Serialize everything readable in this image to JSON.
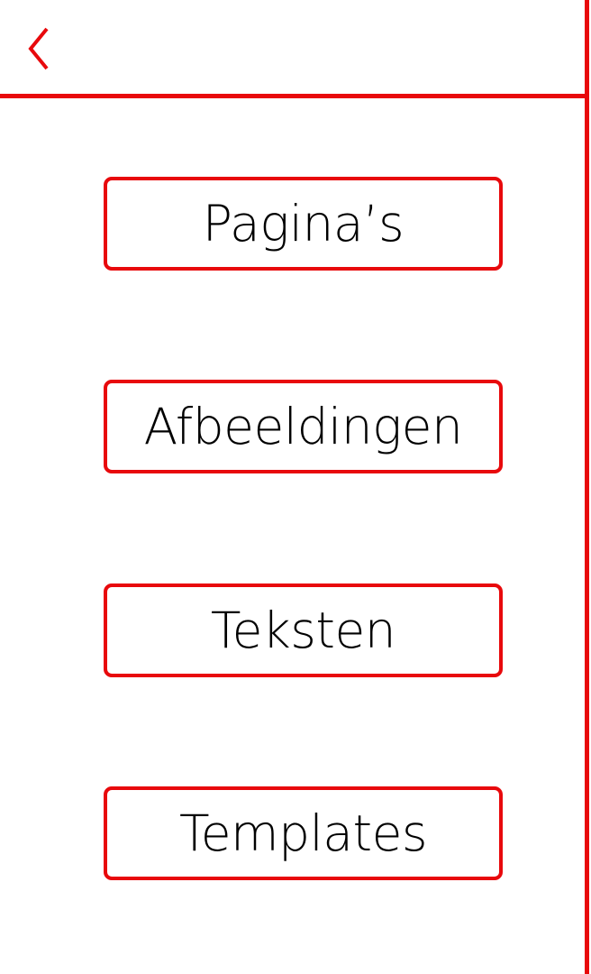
{
  "colors": {
    "accent": "#e8090c",
    "background": "#ffffff",
    "text": "#000000"
  },
  "header": {
    "back_icon": "chevron-left-icon"
  },
  "menu": {
    "items": [
      {
        "label": "Pagina’s"
      },
      {
        "label": "Afbeeldingen"
      },
      {
        "label": "Teksten"
      },
      {
        "label": "Templates"
      }
    ]
  }
}
